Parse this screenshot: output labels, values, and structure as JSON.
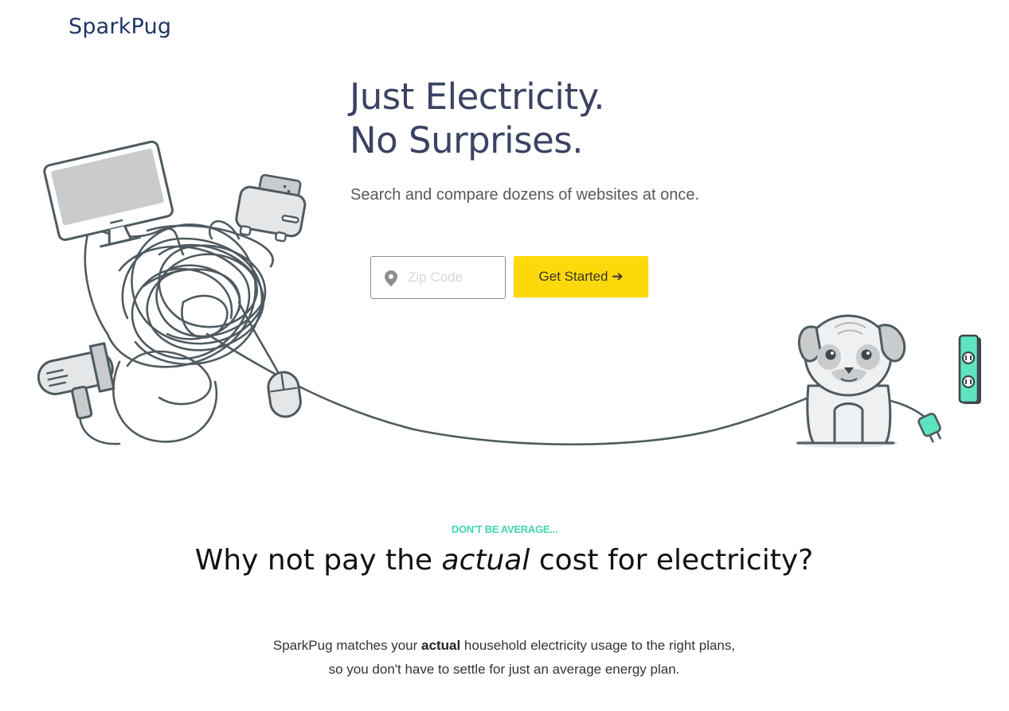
{
  "brand": {
    "logo_text": "SparkPug"
  },
  "hero": {
    "title_line1": "Just Electricity.",
    "title_line2": "No Surprises.",
    "subtitle": "Search and compare dozens of websites at once.",
    "zip_placeholder": "Zip Code",
    "zip_value": "",
    "cta_label": "Get Started ➔"
  },
  "section": {
    "eyebrow": "DON'T BE AVERAGE...",
    "headline_before": "Why not pay the",
    "headline_emphasis": "actual",
    "headline_after": "cost for electricity?",
    "body_before": "SparkPug matches your",
    "body_bold": "actual",
    "body_after": "household electricity usage to the right plans,",
    "body_line2": "so you don't have to settle for just an average energy plan."
  },
  "icons": [
    "map-pin-icon",
    "monitor-icon",
    "toaster-icon",
    "hair-dryer-icon",
    "mouse-icon",
    "pug-mascot",
    "plug-icon",
    "power-outlet-icon"
  ],
  "colors": {
    "brand_navy": "#1f3566",
    "cta_yellow": "#fdd90c",
    "accent_teal": "#42d4ad",
    "title_slate": "#3c4262",
    "line_gray": "#4f5a60"
  }
}
